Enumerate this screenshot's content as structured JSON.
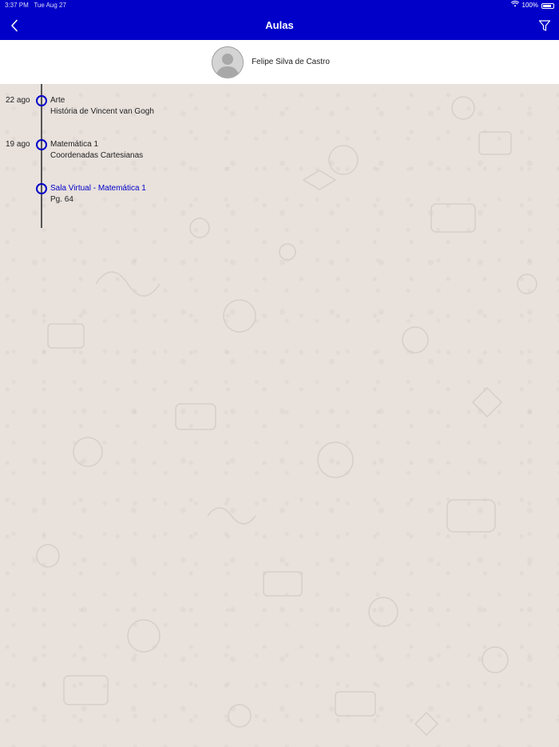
{
  "status_bar": {
    "time": "3:37 PM",
    "date": "Tue Aug 27",
    "battery": "100%"
  },
  "nav": {
    "title": "Aulas"
  },
  "user": {
    "name": "Felipe Silva de Castro"
  },
  "lessons": [
    {
      "date": "22 ago",
      "title": "Arte",
      "subtitle": "História de Vincent van Gogh"
    },
    {
      "date": "19 ago",
      "title": "Matemática 1",
      "subtitle": "Coordenadas Cartesianas"
    },
    {
      "date": "",
      "title": "Sala Virtual - Matemática 1",
      "subtitle": "Pg. 64"
    }
  ],
  "colors": {
    "brand": "#0000c8",
    "background": "#e8e1dc"
  }
}
